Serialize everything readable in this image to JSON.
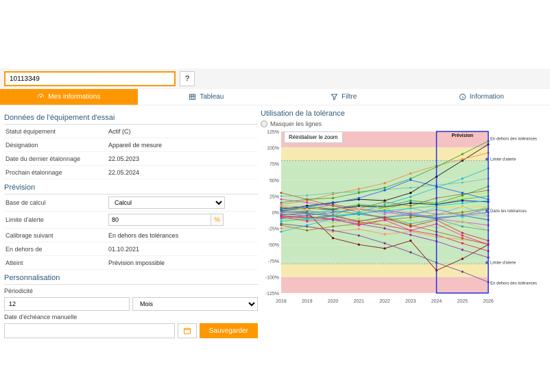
{
  "search": {
    "value": "10113349",
    "help": "?"
  },
  "tabs": {
    "info": "Mes informations",
    "table": "Tableau",
    "filter": "Filtre",
    "information": "Information"
  },
  "sections": {
    "equipment": "Données de l'équipement d'essai",
    "forecast": "Prévision",
    "personalisation": "Personnalisation"
  },
  "equip": {
    "status_label": "Statut équipement",
    "status_value": "Actif (C)",
    "desig_label": "Désignation",
    "desig_value": "Appareil de mesure",
    "lastcal_label": "Date du dernier étalonnage",
    "lastcal_value": "22.05.2023",
    "nextcal_label": "Prochain étalonnage",
    "nextcal_value": "22.05.2024"
  },
  "forecast": {
    "base_label": "Base de calcul",
    "base_value": "Calcul",
    "limit_label": "Limite d'alerte",
    "limit_value": "80",
    "calnext_label": "Calibrage suivant",
    "calnext_value": "En dehors des tolérances",
    "outof_label": "En dehors de",
    "outof_value": "01.10.2021",
    "reached_label": "Atteint",
    "reached_value": "Prévision impossible"
  },
  "personal": {
    "period_label": "Périodicité",
    "period_value": "12",
    "period_unit": "Mois",
    "due_label": "Date d'échéance manuelle",
    "save": "Sauvegarder"
  },
  "chart": {
    "title": "Utilisation de la tolérance",
    "hide_lines": "Masquer les lignes",
    "reset": "Réinitialiser le zoom",
    "legend": {
      "forecast": "Prévision",
      "out_top": "En dehors des tolérances",
      "alert_top": "Limite d'alerte",
      "within": "Dans les tolérances",
      "alert_bot": "Limite d'alerte",
      "out_bot": "En dehors des tolérances"
    }
  },
  "chart_data": {
    "type": "line",
    "xlabel": "",
    "ylabel": "",
    "x_ticks": [
      2018,
      2019,
      2020,
      2021,
      2022,
      2023,
      2024,
      2025,
      2026
    ],
    "y_ticks": [
      125,
      100,
      75,
      50,
      25,
      0,
      -25,
      -50,
      -75,
      -100,
      -125
    ],
    "ylim": [
      -125,
      125
    ],
    "bands": [
      {
        "from": 100,
        "to": 125,
        "color": "#f4c2c2"
      },
      {
        "from": 80,
        "to": 100,
        "color": "#f7eab0"
      },
      {
        "from": -80,
        "to": 80,
        "color": "#c8e8c0"
      },
      {
        "from": -100,
        "to": -80,
        "color": "#f7eab0"
      },
      {
        "from": -125,
        "to": -100,
        "color": "#f4c2c2"
      }
    ],
    "forecast_box": {
      "x_from": 2024,
      "x_to": 2026
    },
    "series": [
      {
        "color": "#000000",
        "values": [
          5,
          10,
          15,
          20,
          18,
          30,
          55,
          80,
          105
        ]
      },
      {
        "color": "#e6194B",
        "values": [
          -5,
          -8,
          -10,
          -15,
          -20,
          -28,
          -35,
          -48,
          -60
        ]
      },
      {
        "color": "#3cb44b",
        "values": [
          0,
          2,
          -5,
          10,
          5,
          15,
          12,
          20,
          25
        ]
      },
      {
        "color": "#4363d8",
        "values": [
          -10,
          -5,
          0,
          5,
          2,
          -2,
          -8,
          -5,
          0
        ]
      },
      {
        "color": "#f58231",
        "values": [
          12,
          18,
          28,
          36,
          45,
          60,
          72,
          82,
          92
        ]
      },
      {
        "color": "#911eb4",
        "values": [
          -2,
          -6,
          -12,
          -18,
          -25,
          -35,
          -45,
          -58,
          -70
        ]
      },
      {
        "color": "#42d4f4",
        "values": [
          3,
          -3,
          4,
          -4,
          6,
          -6,
          8,
          -8,
          10
        ]
      },
      {
        "color": "#f032e6",
        "values": [
          20,
          15,
          10,
          5,
          0,
          -5,
          -10,
          -15,
          -20
        ]
      },
      {
        "color": "#bfef45",
        "values": [
          -15,
          -10,
          -5,
          0,
          5,
          10,
          15,
          22,
          30
        ]
      },
      {
        "color": "#469990",
        "values": [
          -8,
          -12,
          -6,
          -14,
          -7,
          -18,
          -10,
          -22,
          -28
        ]
      },
      {
        "color": "#9A6324",
        "values": [
          8,
          4,
          12,
          6,
          16,
          10,
          22,
          28,
          34
        ]
      },
      {
        "color": "#800000",
        "values": [
          0,
          0,
          -40,
          -50,
          -56,
          -44,
          -90,
          -72,
          -50
        ]
      },
      {
        "color": "#808000",
        "values": [
          -20,
          -28,
          -22,
          -18,
          -12,
          -8,
          -4,
          0,
          6
        ]
      },
      {
        "color": "#000075",
        "values": [
          2,
          6,
          4,
          10,
          8,
          14,
          12,
          18,
          16
        ]
      },
      {
        "color": "#a9a9a9",
        "values": [
          -3,
          -1,
          -5,
          -2,
          -7,
          -3,
          -9,
          -5,
          -11
        ]
      },
      {
        "color": "#66c2a5",
        "values": [
          25,
          26,
          30,
          32,
          35,
          38,
          42,
          46,
          52
        ]
      },
      {
        "color": "#fc8d62",
        "values": [
          -25,
          -22,
          -30,
          -26,
          -34,
          -30,
          -38,
          -42,
          -48
        ]
      },
      {
        "color": "#8da0cb",
        "values": [
          -1,
          3,
          -2,
          5,
          -3,
          7,
          -4,
          9,
          -5
        ]
      },
      {
        "color": "#e78ac3",
        "values": [
          10,
          8,
          6,
          4,
          2,
          0,
          -2,
          -4,
          -6
        ]
      },
      {
        "color": "#a6d854",
        "values": [
          -12,
          -8,
          -16,
          -10,
          -20,
          -12,
          -24,
          -14,
          -28
        ]
      },
      {
        "color": "#ffd92f",
        "values": [
          5,
          5,
          6,
          6,
          7,
          7,
          8,
          8,
          9
        ]
      },
      {
        "color": "#1f78b4",
        "values": [
          -4,
          -2,
          -6,
          -3,
          -8,
          -4,
          -10,
          -5,
          -12
        ]
      },
      {
        "color": "#33a02c",
        "values": [
          15,
          20,
          22,
          30,
          38,
          52,
          70,
          90,
          110
        ]
      },
      {
        "color": "#6a3d9a",
        "values": [
          -18,
          -22,
          -28,
          -36,
          -48,
          -62,
          -78,
          -92,
          -108
        ]
      },
      {
        "color": "#b15928",
        "values": [
          30,
          20,
          10,
          0,
          -10,
          -20,
          -30,
          -40,
          -50
        ]
      },
      {
        "color": "#17becf",
        "values": [
          -30,
          -20,
          -10,
          0,
          12,
          24,
          38,
          52,
          68
        ]
      },
      {
        "color": "#2ca02c",
        "values": [
          6,
          8,
          5,
          12,
          9,
          18,
          14,
          26,
          40
        ]
      },
      {
        "color": "#d62728",
        "values": [
          -6,
          -9,
          -5,
          -14,
          -8,
          -22,
          -12,
          -32,
          -44
        ]
      },
      {
        "color": "#7f7f7f",
        "values": [
          1,
          -1,
          2,
          -2,
          3,
          -3,
          4,
          -4,
          5
        ]
      },
      {
        "color": "#1a55FF",
        "values": [
          4,
          8,
          14,
          22,
          34,
          50,
          40,
          30,
          20
        ]
      },
      {
        "color": "#00CED1",
        "values": [
          -14,
          -10,
          -6,
          -2,
          2,
          6,
          10,
          14,
          18
        ]
      },
      {
        "color": "#FF1493",
        "values": [
          -7,
          -14,
          -10,
          -20,
          -12,
          -28,
          -18,
          -36,
          -50
        ]
      }
    ]
  }
}
